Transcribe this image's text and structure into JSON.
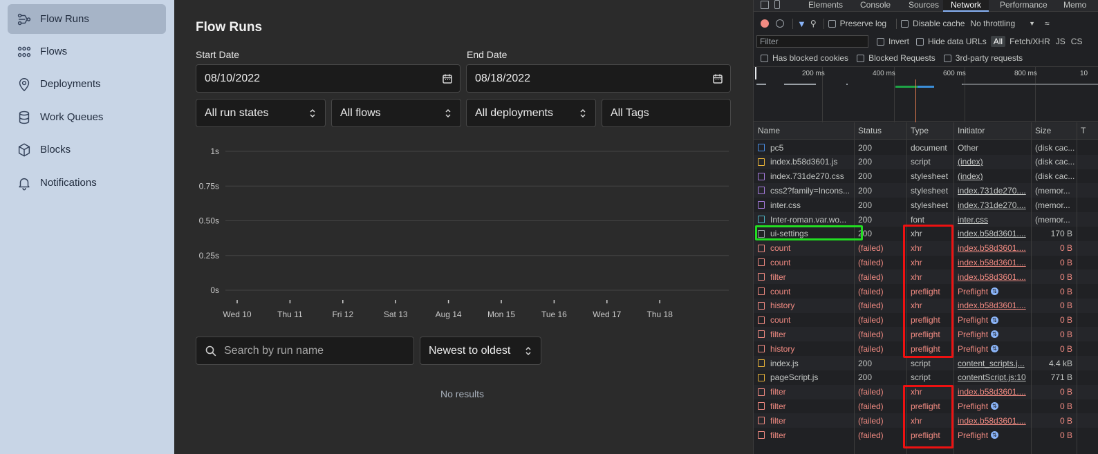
{
  "sidebar": {
    "items": [
      {
        "label": "Flow Runs",
        "icon": "flow-runs-icon"
      },
      {
        "label": "Flows",
        "icon": "flows-icon"
      },
      {
        "label": "Deployments",
        "icon": "location-pin-icon"
      },
      {
        "label": "Work Queues",
        "icon": "database-icon"
      },
      {
        "label": "Blocks",
        "icon": "cube-icon"
      },
      {
        "label": "Notifications",
        "icon": "bell-icon"
      }
    ]
  },
  "main": {
    "title": "Flow Runs",
    "start_date_label": "Start Date",
    "start_date_value": "08/10/2022",
    "end_date_label": "End Date",
    "end_date_value": "08/18/2022",
    "filters": {
      "run_states": "All run states",
      "flows": "All flows",
      "deployments": "All deployments",
      "tags": "All Tags"
    },
    "search_placeholder": "Search by run name",
    "sort": "Newest to oldest",
    "empty_text": "No results"
  },
  "chart_data": {
    "type": "bar",
    "categories": [
      "Wed 10",
      "Thu 11",
      "Fri 12",
      "Sat 13",
      "Aug 14",
      "Mon 15",
      "Tue 16",
      "Wed 17",
      "Thu 18"
    ],
    "y_tick_labels": [
      "1s",
      "0.75s",
      "0.50s",
      "0.25s",
      "0s"
    ],
    "ylim": [
      0,
      1
    ],
    "values": [],
    "grid": true
  },
  "devtools": {
    "tabs": [
      "Elements",
      "Console",
      "Sources",
      "Network",
      "Performance",
      "Memo"
    ],
    "active_tab": "Network",
    "toolbar": {
      "preserve_log": "Preserve log",
      "disable_cache": "Disable cache",
      "throttling": "No throttling"
    },
    "filter_bar": {
      "placeholder": "Filter",
      "invert": "Invert",
      "hide_data_urls": "Hide data URLs",
      "types": [
        "All",
        "Fetch/XHR",
        "JS",
        "CS"
      ]
    },
    "blocked_bar": {
      "blocked_cookies": "Has blocked cookies",
      "blocked_requests": "Blocked Requests",
      "third_party": "3rd-party requests"
    },
    "timeline_labels": [
      "200 ms",
      "400 ms",
      "600 ms",
      "800 ms",
      "10"
    ],
    "columns": [
      "Name",
      "Status",
      "Type",
      "Initiator",
      "Size",
      "T"
    ],
    "requests": [
      {
        "name": "pc5",
        "status": "200",
        "type": "document",
        "initiator": "Other",
        "size": "(disk cac...",
        "failed": false,
        "icon_color": "#4a8fe7",
        "initiator_link": false
      },
      {
        "name": "index.b58d3601.js",
        "status": "200",
        "type": "script",
        "initiator": "(index)",
        "size": "(disk cac...",
        "failed": false,
        "icon_color": "#e8b339",
        "initiator_link": true
      },
      {
        "name": "index.731de270.css",
        "status": "200",
        "type": "stylesheet",
        "initiator": "(index)",
        "size": "(disk cac...",
        "failed": false,
        "icon_color": "#a87ce0",
        "initiator_link": true
      },
      {
        "name": "css2?family=Incons...",
        "status": "200",
        "type": "stylesheet",
        "initiator": "index.731de270....",
        "size": "(memor...",
        "failed": false,
        "icon_color": "#a87ce0",
        "initiator_link": true
      },
      {
        "name": "inter.css",
        "status": "200",
        "type": "stylesheet",
        "initiator": "index.731de270....",
        "size": "(memor...",
        "failed": false,
        "icon_color": "#a87ce0",
        "initiator_link": true
      },
      {
        "name": "Inter-roman.var.wo...",
        "status": "200",
        "type": "font",
        "initiator": "inter.css",
        "size": "(memor...",
        "failed": false,
        "icon_color": "#4fb6c7",
        "initiator_link": true
      },
      {
        "name": "ui-settings",
        "status": "200",
        "type": "xhr",
        "initiator": "index.b58d3601....",
        "size": "170 B",
        "failed": false,
        "icon_color": "#9aa0a6",
        "initiator_link": true
      },
      {
        "name": "count",
        "status": "(failed)",
        "type": "xhr",
        "initiator": "index.b58d3601....",
        "size": "0 B",
        "failed": true,
        "icon_color": "#f28b82",
        "initiator_link": true
      },
      {
        "name": "count",
        "status": "(failed)",
        "type": "xhr",
        "initiator": "index.b58d3601....",
        "size": "0 B",
        "failed": true,
        "icon_color": "#f28b82",
        "initiator_link": true
      },
      {
        "name": "filter",
        "status": "(failed)",
        "type": "xhr",
        "initiator": "index.b58d3601....",
        "size": "0 B",
        "failed": true,
        "icon_color": "#f28b82",
        "initiator_link": true
      },
      {
        "name": "count",
        "status": "(failed)",
        "type": "preflight",
        "initiator": "Preflight",
        "size": "0 B",
        "failed": true,
        "icon_color": "#f28b82",
        "initiator_link": false,
        "preflight": true
      },
      {
        "name": "history",
        "status": "(failed)",
        "type": "xhr",
        "initiator": "index.b58d3601....",
        "size": "0 B",
        "failed": true,
        "icon_color": "#f28b82",
        "initiator_link": true
      },
      {
        "name": "count",
        "status": "(failed)",
        "type": "preflight",
        "initiator": "Preflight",
        "size": "0 B",
        "failed": true,
        "icon_color": "#f28b82",
        "initiator_link": false,
        "preflight": true
      },
      {
        "name": "filter",
        "status": "(failed)",
        "type": "preflight",
        "initiator": "Preflight",
        "size": "0 B",
        "failed": true,
        "icon_color": "#f28b82",
        "initiator_link": false,
        "preflight": true
      },
      {
        "name": "history",
        "status": "(failed)",
        "type": "preflight",
        "initiator": "Preflight",
        "size": "0 B",
        "failed": true,
        "icon_color": "#f28b82",
        "initiator_link": false,
        "preflight": true
      },
      {
        "name": "index.js",
        "status": "200",
        "type": "script",
        "initiator": "content_scripts.j...",
        "size": "4.4 kB",
        "failed": false,
        "icon_color": "#e8b339",
        "initiator_link": true
      },
      {
        "name": "pageScript.js",
        "status": "200",
        "type": "script",
        "initiator": "contentScript.js:10",
        "size": "771 B",
        "failed": false,
        "icon_color": "#e8b339",
        "initiator_link": true
      },
      {
        "name": "filter",
        "status": "(failed)",
        "type": "xhr",
        "initiator": "index.b58d3601....",
        "size": "0 B",
        "failed": true,
        "icon_color": "#f28b82",
        "initiator_link": true
      },
      {
        "name": "filter",
        "status": "(failed)",
        "type": "preflight",
        "initiator": "Preflight",
        "size": "0 B",
        "failed": true,
        "icon_color": "#f28b82",
        "initiator_link": false,
        "preflight": true
      },
      {
        "name": "filter",
        "status": "(failed)",
        "type": "xhr",
        "initiator": "index.b58d3601....",
        "size": "0 B",
        "failed": true,
        "icon_color": "#f28b82",
        "initiator_link": true
      },
      {
        "name": "filter",
        "status": "(failed)",
        "type": "preflight",
        "initiator": "Preflight",
        "size": "0 B",
        "failed": true,
        "icon_color": "#f28b82",
        "initiator_link": false,
        "preflight": true
      }
    ],
    "highlight_colors": {
      "green": "#22dd22",
      "red": "#ee1111"
    }
  }
}
